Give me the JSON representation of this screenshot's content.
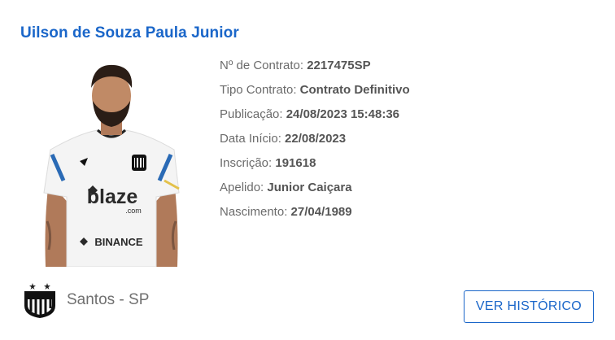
{
  "player": {
    "name": "Uilson de Souza Paula Junior",
    "photo_icon": "player-photo-icon",
    "jersey_sponsor_main": "blaze",
    "jersey_sponsor_sub": ".com",
    "jersey_sponsor_bottom": "BINANCE"
  },
  "details": [
    {
      "label": "Nº de Contrato: ",
      "value": "2217475SP"
    },
    {
      "label": "Tipo Contrato: ",
      "value": "Contrato Definitivo"
    },
    {
      "label": "Publicação: ",
      "value": "24/08/2023 15:48:36"
    },
    {
      "label": "Data Início: ",
      "value": "22/08/2023"
    },
    {
      "label": "Inscrição: ",
      "value": "191618"
    },
    {
      "label": "Apelido: ",
      "value": "Junior Caiçara"
    },
    {
      "label": "Nascimento: ",
      "value": "27/04/1989"
    }
  ],
  "club": {
    "name": "Santos - SP",
    "crest_icon": "santos-crest-icon"
  },
  "actions": {
    "history_label": "VER HISTÓRICO"
  },
  "colors": {
    "accent": "#1a66c9",
    "label_text": "#6b6b6b",
    "value_text": "#555555"
  }
}
